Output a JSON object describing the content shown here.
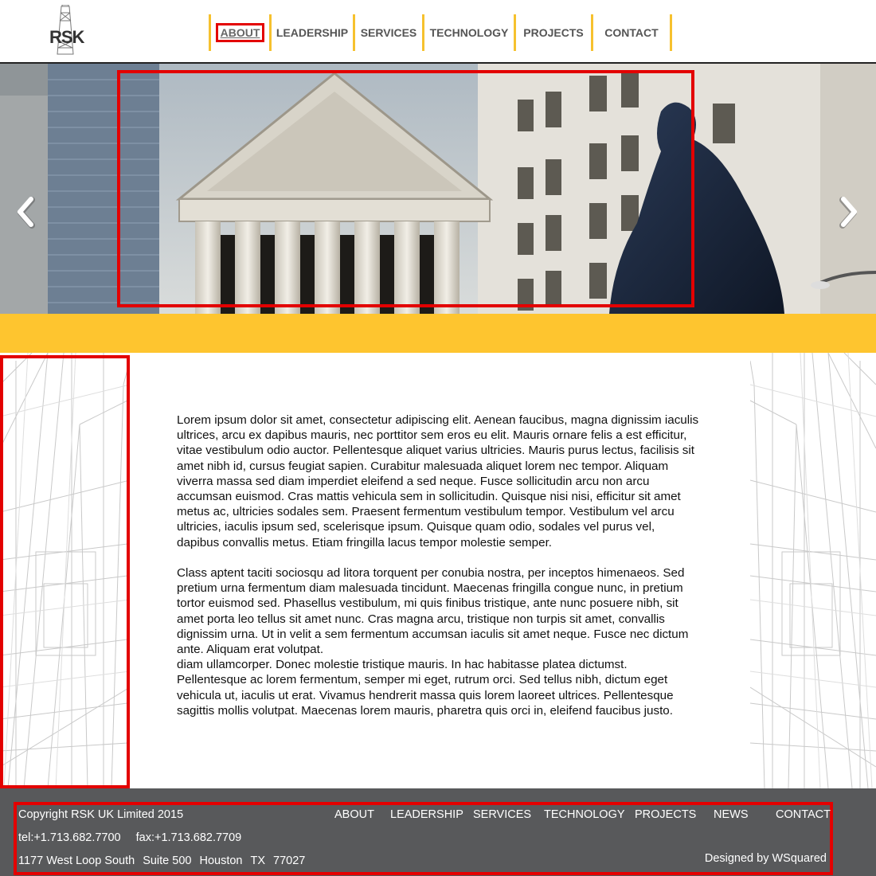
{
  "header": {
    "logo_text": "RSK",
    "nav": [
      {
        "label": "ABOUT",
        "active": true
      },
      {
        "label": "LEADERSHIP",
        "active": false
      },
      {
        "label": "SERVICES",
        "active": false
      },
      {
        "label": "TECHNOLOGY",
        "active": false
      },
      {
        "label": "PROJECTS",
        "active": false
      },
      {
        "label": "CONTACT",
        "active": false
      }
    ]
  },
  "hero": {
    "prev_icon": "chevron-left-icon",
    "next_icon": "chevron-right-icon"
  },
  "colors": {
    "accent_yellow": "#fec52f",
    "footer_gray": "#58595b",
    "highlight_red": "#e30000"
  },
  "content": {
    "paragraph1": "Lorem ipsum dolor sit amet, consectetur adipiscing elit. Aenean faucibus, magna dignissim iaculis ultrices, arcu ex dapibus mauris, nec porttitor sem eros eu elit. Mauris ornare felis a est efficitur, vitae vestibulum odio auctor. Pellentesque aliquet varius ultricies. Mauris purus lectus, facilisis sit amet nibh id, cursus feugiat sapien. Curabitur malesuada aliquet lorem nec tempor. Aliquam viverra massa sed diam imperdiet eleifend a sed neque. Fusce sollicitudin arcu non arcu accumsan euismod. Cras mattis vehicula sem in sollicitudin. Quisque nisi nisi, efficitur sit amet metus ac, ultricies sodales sem. Praesent fermentum vestibulum tempor. Vestibulum vel arcu ultricies, iaculis ipsum sed, scelerisque ipsum. Quisque quam odio, sodales vel purus vel, dapibus convallis metus. Etiam fringilla lacus tempor molestie semper.",
    "paragraph2": "Class aptent taciti sociosqu ad litora torquent per conubia nostra, per inceptos himenaeos. Sed pretium urna fermentum diam malesuada tincidunt. Maecenas fringilla congue nunc, in pretium tortor euismod sed. Phasellus vestibulum, mi quis finibus tristique, ante nunc posuere nibh, sit amet porta leo tellus sit amet nunc. Cras magna arcu, tristique non turpis sit amet, convallis dignissim urna. Ut in velit a sem fermentum accumsan iaculis sit amet neque. Fusce nec dictum ante. Aliquam erat volutpat.",
    "paragraph3": "diam ullamcorper. Donec molestie tristique mauris. In hac habitasse platea dictumst. Pellentesque ac lorem fermentum, semper mi eget, rutrum orci. Sed tellus nibh, dictum eget vehicula ut, iaculis ut erat. Vivamus hendrerit massa quis lorem laoreet ultrices. Pellentesque sagittis mollis volutpat. Maecenas lorem mauris, pharetra quis orci in, eleifend faucibus justo."
  },
  "footer": {
    "copyright": "Copyright RSK UK Limited 2015",
    "tel": "tel:+1.713.682.7700",
    "fax": "fax:+1.713.682.7709",
    "address_street": "1177 West Loop South",
    "address_suite": "Suite 500",
    "address_city": "Houston",
    "address_state": "TX",
    "address_zip": "77027",
    "nav": [
      "ABOUT",
      "LEADERSHIP",
      "SERVICES",
      "TECHNOLOGY",
      "PROJECTS",
      "NEWS",
      "CONTACT"
    ],
    "designed_by": "Designed by WSquared"
  }
}
